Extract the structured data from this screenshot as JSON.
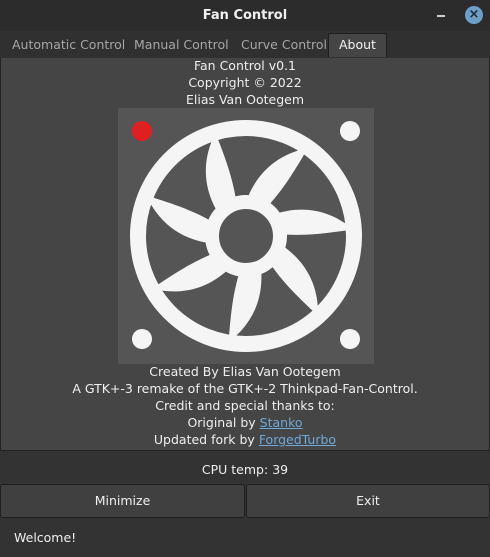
{
  "window": {
    "title": "Fan Control",
    "minimize_glyph": "–",
    "close_glyph": "×"
  },
  "tabs": [
    {
      "label": "Automatic Control",
      "active": false
    },
    {
      "label": "Manual Control",
      "active": false
    },
    {
      "label": "Curve Control",
      "active": false
    },
    {
      "label": "About",
      "active": true
    }
  ],
  "about": {
    "app_name": "Fan Control v0.1",
    "copyright": "Copyright  © 2022",
    "author": "Elias Van Ootegem",
    "logo_icon": "fan-icon",
    "created_by": "Created By Elias Van Ootegem",
    "description": "A GTK+-3 remake of the GTK+-2 Thinkpad-Fan-Control.",
    "credits_heading": "Credit and special thanks to:",
    "original_prefix": "Original by",
    "original_link": "Stanko",
    "fork_prefix": "Updated fork by",
    "fork_link": "ForgedTurbo"
  },
  "status": {
    "cpu_temp_label": "CPU temp:",
    "cpu_temp_value": "39"
  },
  "buttons": {
    "minimize": "Minimize",
    "exit": "Exit"
  },
  "statusbar": {
    "message": "Welcome!"
  },
  "colors": {
    "accent_red": "#e02020",
    "link": "#6ea8d8",
    "close_button": "#6e9fc9"
  }
}
